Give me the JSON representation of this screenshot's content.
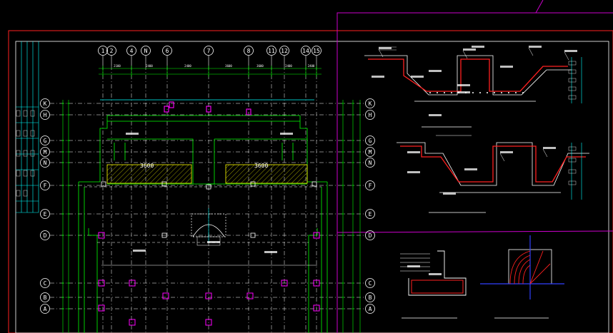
{
  "drawing": {
    "top_axes": [
      "1",
      "2",
      "4",
      "N",
      "6",
      "7",
      "8",
      "11",
      "12",
      "14",
      "15"
    ],
    "side_axes": [
      "K",
      "H",
      "G",
      "M",
      "N",
      "F",
      "E",
      "D",
      "C",
      "B",
      "A"
    ],
    "dims_top": [
      "2100",
      "2400",
      "2400",
      "3600",
      "3600",
      "2400",
      "2400",
      "2100"
    ],
    "hatch_labels": [
      "3600",
      "3600"
    ],
    "section_titles": [
      "",
      "",
      ""
    ],
    "colors": {
      "background": "#000000",
      "border": "#ff0000",
      "frame": "#cc00cc",
      "grid": "#ffffff",
      "axis_circle": "#ffffff",
      "walls": "#00ff00",
      "columns": "#ff00ff",
      "accent": "#00ffff",
      "rebar": "#ff2020",
      "hatch": "#ffff00",
      "blue": "#3040ff"
    }
  }
}
